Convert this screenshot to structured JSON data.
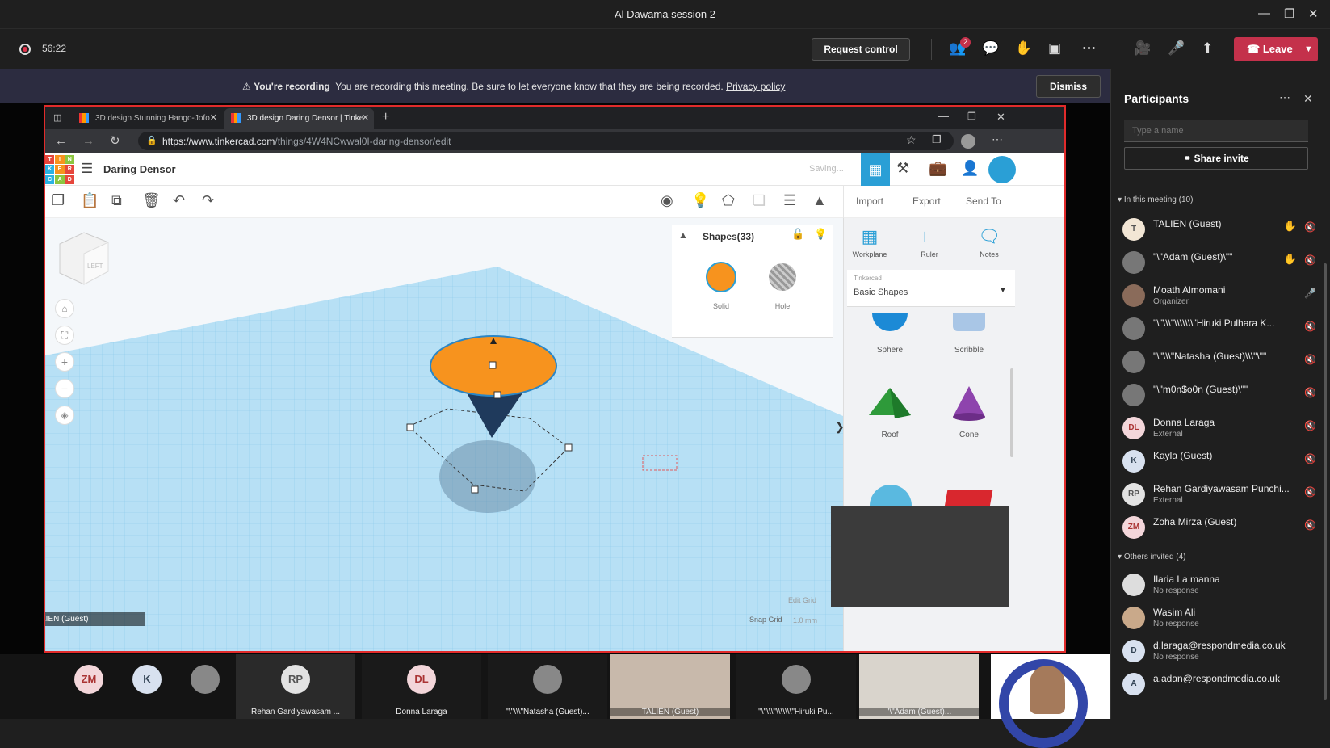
{
  "window": {
    "title": "Al Dawama session 2"
  },
  "toolbar": {
    "timer": "56:22",
    "request_control": "Request control",
    "participants_badge": "2",
    "leave_label": "Leave"
  },
  "banner": {
    "title": "You're recording",
    "message": "You are recording this meeting. Be sure to let everyone know that they are being recorded.",
    "link": "Privacy policy",
    "dismiss": "Dismiss"
  },
  "browser": {
    "tabs": [
      {
        "title": "3D design Stunning Hango-Jofo"
      },
      {
        "title": "3D design Daring Densor | Tinke"
      }
    ],
    "url_host": "https://www.tinkercad.com",
    "url_path": "/things/4W4NCwwal0I-daring-densor/edit"
  },
  "tinkercad": {
    "logo_letters": [
      "T",
      "I",
      "N",
      "K",
      "E",
      "R",
      "C",
      "A",
      "D"
    ],
    "design_name": "Daring Densor",
    "status": "Saving...",
    "import": "Import",
    "export": "Export",
    "send_to": "Send To",
    "shapes_title": "Shapes(33)",
    "solid": "Solid",
    "hole": "Hole",
    "workplane": "Workplane",
    "ruler": "Ruler",
    "notes": "Notes",
    "lib_source": "Tinkercad",
    "lib_name": "Basic Shapes",
    "shapes": [
      "Sphere",
      "Scribble",
      "Roof",
      "Cone"
    ],
    "edit_grid": "Edit Grid",
    "snap_grid": "Snap Grid",
    "snap_value": "1.0 mm",
    "viewcube_face": "LEFT",
    "overlay_name": "TALIEN (Guest)",
    "colors": {
      "orange": "#f7931e",
      "grid": "#a9d8f2"
    }
  },
  "participants": {
    "title": "Participants",
    "search_placeholder": "Type a name",
    "share_invite": "Share invite",
    "in_meeting_header": "In this meeting (10)",
    "others_header": "Others invited (4)",
    "in_meeting": [
      {
        "initials": "T",
        "name": "TALIEN (Guest)",
        "sub": ""
      },
      {
        "initials": "",
        "name": "\"\\\"Adam (Guest)\\\"\"",
        "sub": ""
      },
      {
        "initials": "",
        "name": "Moath Almomani",
        "sub": "Organizer"
      },
      {
        "initials": "",
        "name": "\"\\\"\\\\\\\"\\\\\\\\\\\\\\\"Hiruki Pulhara K...",
        "sub": ""
      },
      {
        "initials": "",
        "name": "\"\\\"\\\\\\\"Natasha (Guest)\\\\\\\"\\\"\"",
        "sub": ""
      },
      {
        "initials": "",
        "name": "\"\\\"m0n$o0n (Guest)\\\"\"",
        "sub": ""
      },
      {
        "initials": "DL",
        "name": "Donna Laraga",
        "sub": "External"
      },
      {
        "initials": "K",
        "name": "Kayla (Guest)",
        "sub": ""
      },
      {
        "initials": "RP",
        "name": "Rehan Gardiyawasam Punchi...",
        "sub": "External"
      },
      {
        "initials": "ZM",
        "name": "Zoha Mirza (Guest)",
        "sub": ""
      }
    ],
    "others": [
      {
        "initials": "",
        "name": "Ilaria La manna",
        "sub": "No response"
      },
      {
        "initials": "",
        "name": "Wasim Ali",
        "sub": "No response"
      },
      {
        "initials": "D",
        "name": "d.laraga@respondmedia.co.uk",
        "sub": "No response"
      },
      {
        "initials": "A",
        "name": "a.adan@respondmedia.co.uk",
        "sub": ""
      }
    ]
  },
  "gallery": [
    {
      "initials": "ZM",
      "label": ""
    },
    {
      "initials": "K",
      "label": ""
    },
    {
      "initials": "",
      "label": ""
    },
    {
      "initials": "RP",
      "label": "Rehan Gardiyawasam ..."
    },
    {
      "initials": "DL",
      "label": "Donna Laraga"
    },
    {
      "initials": "",
      "label": "\"\\\"\\\\\\\"Natasha (Guest)..."
    },
    {
      "initials": "",
      "label": "TALIEN (Guest)"
    },
    {
      "initials": "",
      "label": "\"\\\"\\\\\\\"\\\\\\\\\\\\\\\"Hiruki Pu..."
    },
    {
      "initials": "",
      "label": "\"\\\"Adam (Guest)..."
    }
  ]
}
